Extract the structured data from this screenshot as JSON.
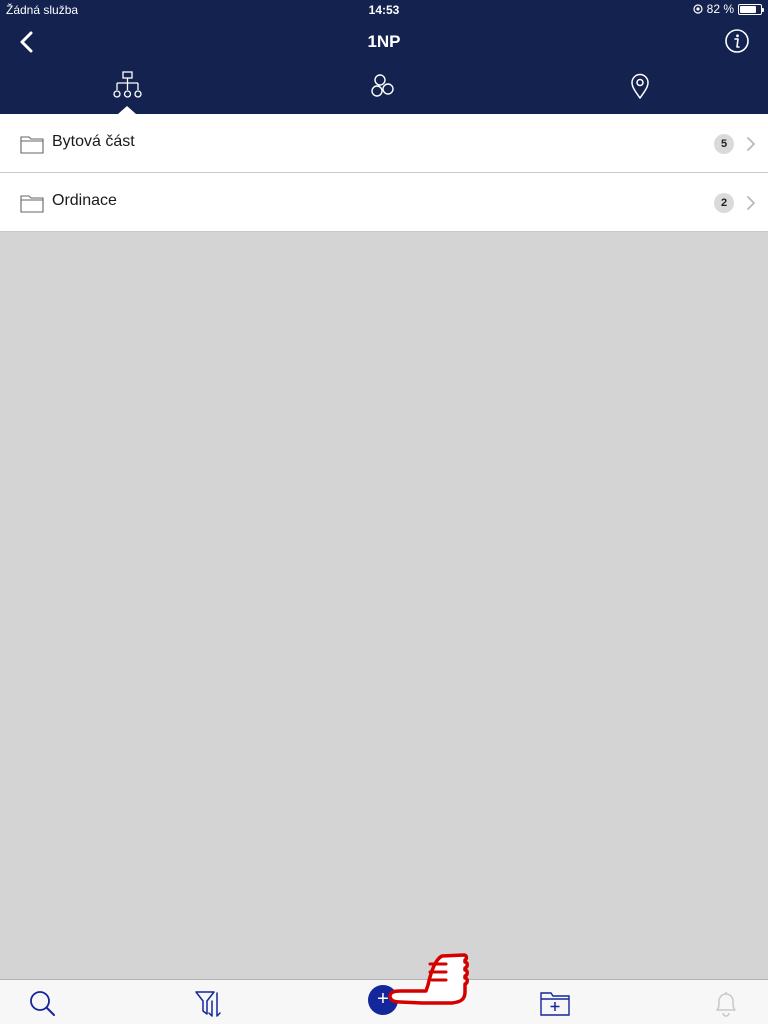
{
  "status_bar": {
    "carrier": "Žádná služba",
    "time": "14:53",
    "battery_text": "82 %",
    "battery_level": 0.82
  },
  "navbar": {
    "title": "1NP",
    "back_icon": "chevron-left-icon",
    "info_icon": "info-icon"
  },
  "view_tabs": [
    {
      "icon": "hierarchy-icon",
      "selected": true
    },
    {
      "icon": "circles-group-icon",
      "selected": false
    },
    {
      "icon": "location-pin-icon",
      "selected": false
    }
  ],
  "folders": [
    {
      "name": "Bytová část",
      "count": "5"
    },
    {
      "name": "Ordinace",
      "count": "2"
    }
  ],
  "bottom_bar": {
    "add_label": "+",
    "items": [
      "search-icon",
      "filter-sort-icon",
      "add-icon",
      "new-folder-icon",
      "bell-icon"
    ]
  },
  "colors": {
    "header_bg": "#13224f",
    "accent": "#13279a",
    "annotation": "#d40000"
  }
}
